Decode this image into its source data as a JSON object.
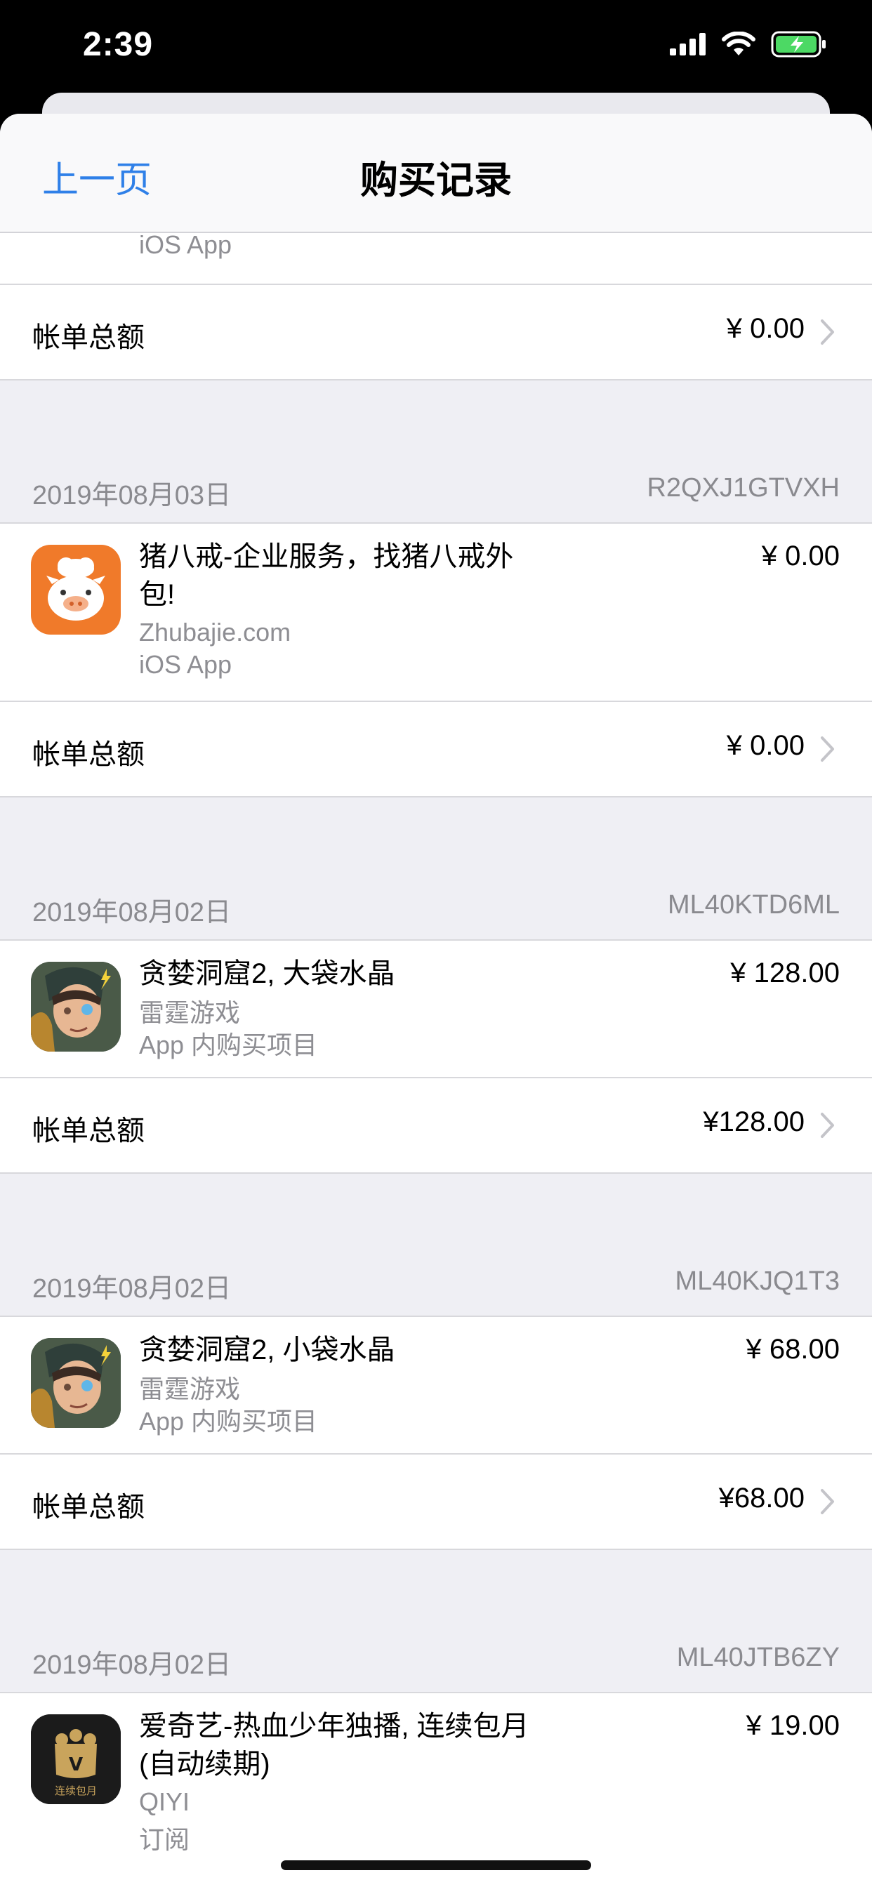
{
  "status_bar": {
    "time": "2:39"
  },
  "nav": {
    "back_label": "上一页",
    "title": "购买记录"
  },
  "top_partial": {
    "kind": "iOS App",
    "total_label": "帐单总额",
    "total_amount": "¥ 0.00"
  },
  "sections": [
    {
      "date": "2019年08月03日",
      "order_id": "R2QXJ1GTVXH",
      "item": {
        "title_line1": "猪八戒-企业服务，找猪八戒外",
        "title_line2": "包!",
        "developer": "Zhubajie.com",
        "kind": "iOS App",
        "price": "¥ 0.00",
        "icon": "pig-app-icon"
      },
      "total_label": "帐单总额",
      "total_amount": "¥ 0.00"
    },
    {
      "date": "2019年08月02日",
      "order_id": "ML40KTD6ML",
      "item": {
        "title_line1": "贪婪洞窟2, 大袋水晶",
        "developer": "雷霆游戏",
        "kind": "App 内购买项目",
        "price": "¥ 128.00",
        "icon": "cave-game-icon"
      },
      "total_label": "帐单总额",
      "total_amount": "¥128.00"
    },
    {
      "date": "2019年08月02日",
      "order_id": "ML40KJQ1T3",
      "item": {
        "title_line1": "贪婪洞窟2, 小袋水晶",
        "developer": "雷霆游戏",
        "kind": "App 内购买项目",
        "price": "¥ 68.00",
        "icon": "cave-game-icon"
      },
      "total_label": "帐单总额",
      "total_amount": "¥68.00"
    },
    {
      "date": "2019年08月02日",
      "order_id": "ML40JTB6ZY",
      "item": {
        "title_line1": "爱奇艺-热血少年独播, 连续包月",
        "title_line2": "(自动续期)",
        "developer": "QIYI",
        "kind": "订阅",
        "price": "¥ 19.00",
        "icon": "iqiyi-vip-icon",
        "icon_text": "连续包月",
        "icon_letter": "V"
      }
    }
  ],
  "colors": {
    "accent": "#2f80e8",
    "pig_orange": "#f07a2a",
    "vip_gold": "#c9a45c"
  }
}
